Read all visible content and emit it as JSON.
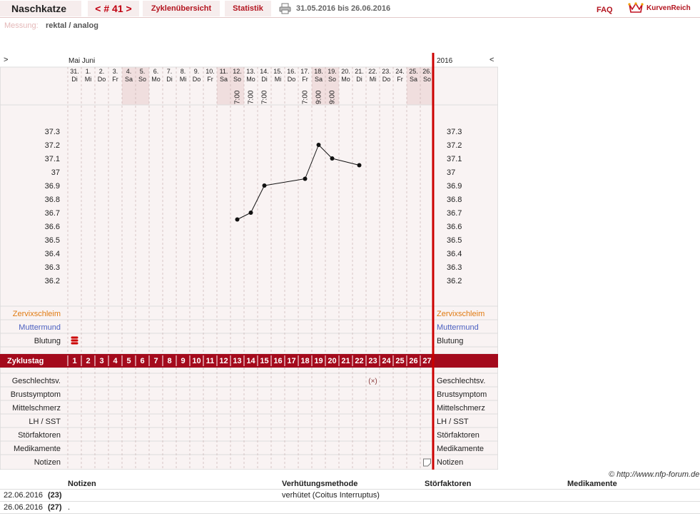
{
  "header": {
    "name": "Naschkatze",
    "cycle_nav": "< # 41 >",
    "overview_tab": "Zyklenübersicht",
    "stats_tab": "Statistik",
    "date_range": "31.05.2016 bis 26.06.2016",
    "faq": "FAQ",
    "logo_text": "KurvenReich"
  },
  "measurement": {
    "label": "Messung:",
    "value": "rektal / analog"
  },
  "chart": {
    "nav_left": ">",
    "nav_right": "<",
    "months": "Mai Juni",
    "year": "2016",
    "days": [
      {
        "d": "31.",
        "w": "Di",
        "t": "",
        "we": false
      },
      {
        "d": "1.",
        "w": "Mi",
        "t": "",
        "we": false
      },
      {
        "d": "2.",
        "w": "Do",
        "t": "",
        "we": false
      },
      {
        "d": "3.",
        "w": "Fr",
        "t": "",
        "we": false
      },
      {
        "d": "4.",
        "w": "Sa",
        "t": "",
        "we": true
      },
      {
        "d": "5.",
        "w": "So",
        "t": "",
        "we": true
      },
      {
        "d": "6.",
        "w": "Mo",
        "t": "",
        "we": false
      },
      {
        "d": "7.",
        "w": "Di",
        "t": "",
        "we": false
      },
      {
        "d": "8.",
        "w": "Mi",
        "t": "",
        "we": false
      },
      {
        "d": "9.",
        "w": "Do",
        "t": "",
        "we": false
      },
      {
        "d": "10.",
        "w": "Fr",
        "t": "",
        "we": false
      },
      {
        "d": "11.",
        "w": "Sa",
        "t": "",
        "we": true
      },
      {
        "d": "12.",
        "w": "So",
        "t": "7:00",
        "we": true
      },
      {
        "d": "13.",
        "w": "Mo",
        "t": "7:00",
        "we": false
      },
      {
        "d": "14.",
        "w": "Di",
        "t": "7:00",
        "we": false
      },
      {
        "d": "15.",
        "w": "Mi",
        "t": "",
        "we": false
      },
      {
        "d": "16.",
        "w": "Do",
        "t": "",
        "we": false
      },
      {
        "d": "17.",
        "w": "Fr",
        "t": "7:00",
        "we": false
      },
      {
        "d": "18.",
        "w": "Sa",
        "t": "9:00",
        "we": true
      },
      {
        "d": "19.",
        "w": "So",
        "t": "9:00",
        "we": true
      },
      {
        "d": "20.",
        "w": "Mo",
        "t": "",
        "we": false
      },
      {
        "d": "21.",
        "w": "Di",
        "t": "",
        "we": false
      },
      {
        "d": "22.",
        "w": "Mi",
        "t": "",
        "we": false
      },
      {
        "d": "23.",
        "w": "Do",
        "t": "",
        "we": false
      },
      {
        "d": "24.",
        "w": "Fr",
        "t": "",
        "we": false
      },
      {
        "d": "25.",
        "w": "Sa",
        "t": "",
        "we": true
      },
      {
        "d": "26.",
        "w": "So",
        "t": "",
        "we": true
      }
    ],
    "temp_ticks": [
      "37.3",
      "37.2",
      "37.1",
      "37",
      "36.9",
      "36.8",
      "36.7",
      "36.6",
      "36.5",
      "36.4",
      "36.3",
      "36.2"
    ],
    "temps": [
      null,
      null,
      null,
      null,
      null,
      null,
      null,
      null,
      null,
      null,
      null,
      null,
      36.65,
      36.7,
      36.9,
      null,
      null,
      36.95,
      37.2,
      37.1,
      null,
      37.05,
      null,
      null,
      null,
      null,
      null
    ],
    "obs_rows": [
      {
        "label": "Zervixschleim",
        "color": "#e07a10"
      },
      {
        "label": "Muttermund",
        "color": "#4a5fc0"
      },
      {
        "label": "Blutung",
        "color": "#222"
      }
    ],
    "cycle_label": "Zyklustag",
    "cycle_days": [
      "1",
      "2",
      "3",
      "4",
      "5",
      "6",
      "7",
      "8",
      "9",
      "10",
      "11",
      "12",
      "13",
      "14",
      "15",
      "16",
      "17",
      "18",
      "19",
      "20",
      "21",
      "22",
      "23",
      "24",
      "25",
      "26",
      "27"
    ],
    "bottom_rows": [
      "Geschlechtsv.",
      "Brustsymptom",
      "Mittelschmerz",
      "LH / SST",
      "Störfaktoren",
      "Medikamente",
      "Notizen"
    ],
    "bleeding_day_index": 0,
    "intercourse_day_index": 22,
    "note_day_index": 26,
    "intercourse_mark": "(×)",
    "colors": {
      "accent": "#a40a1c",
      "weekend": "#f0dede",
      "bg": "#f9f3f3",
      "grid": "#c9b3b3"
    }
  },
  "copyright": "© http://www.nfp-forum.de",
  "notes_table": {
    "headers": {
      "notes": "Notizen",
      "method": "Verhütungsmethode",
      "factors": "Störfaktoren",
      "meds": "Medikamente"
    },
    "rows": [
      {
        "date": "22.06.2016",
        "day": "(23)",
        "note": "",
        "method": "verhütet (Coitus Interruptus)",
        "factors": "",
        "meds": ""
      },
      {
        "date": "26.06.2016",
        "day": "(27)",
        "note": ".",
        "method": "",
        "factors": "",
        "meds": ""
      }
    ]
  }
}
